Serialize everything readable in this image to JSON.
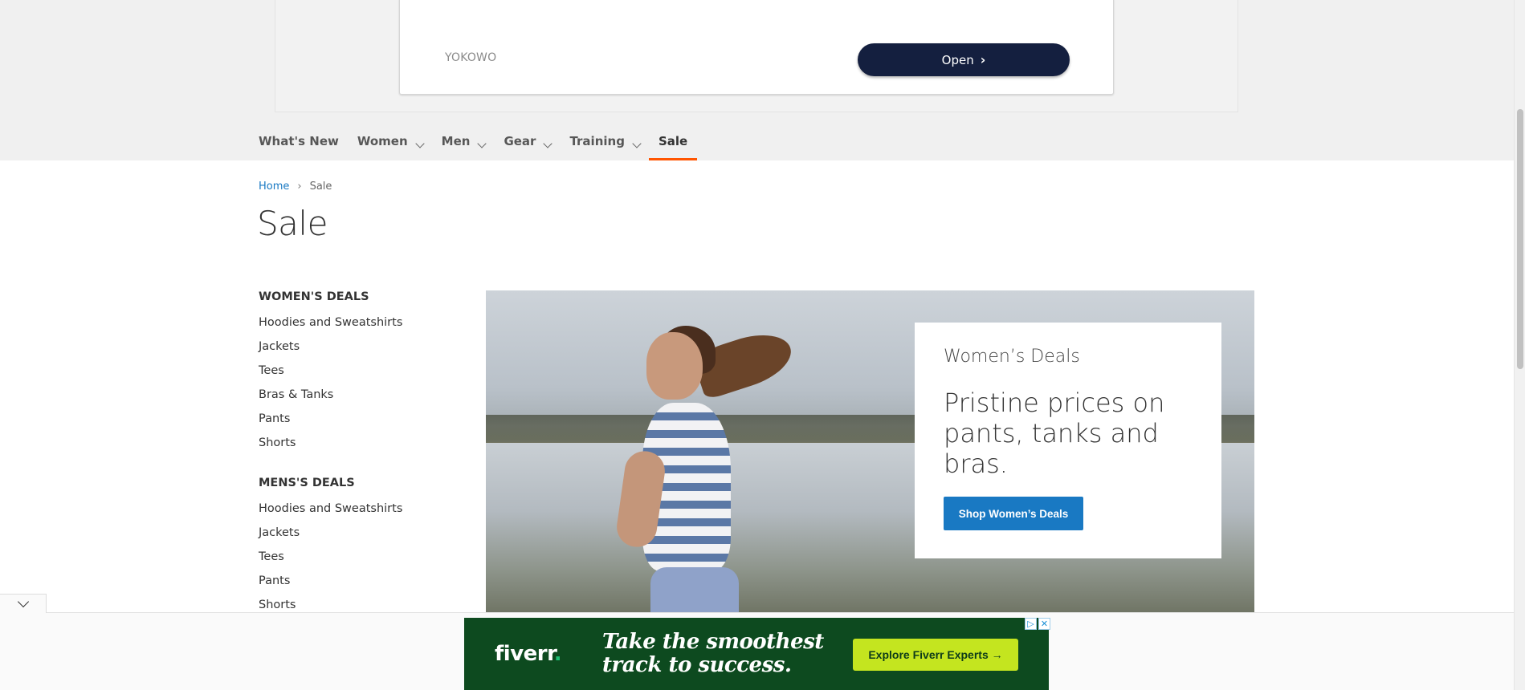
{
  "top_ad": {
    "brand": "YOKOWO",
    "button_label": "Open",
    "button_icon": "chevron-right-icon"
  },
  "nav": {
    "items": [
      {
        "label": "What's New",
        "has_dropdown": false
      },
      {
        "label": "Women",
        "has_dropdown": true
      },
      {
        "label": "Men",
        "has_dropdown": true
      },
      {
        "label": "Gear",
        "has_dropdown": true
      },
      {
        "label": "Training",
        "has_dropdown": true
      },
      {
        "label": "Sale",
        "has_dropdown": false,
        "active": true
      }
    ],
    "accent_color": "#ff5501"
  },
  "breadcrumb": {
    "home": "Home",
    "separator": "›",
    "current": "Sale"
  },
  "page_title": "Sale",
  "sidebar": {
    "groups": [
      {
        "heading": "WOMEN'S DEALS",
        "links": [
          "Hoodies and Sweatshirts",
          "Jackets",
          "Tees",
          "Bras & Tanks",
          "Pants",
          "Shorts"
        ]
      },
      {
        "heading": "MENS'S DEALS",
        "links": [
          "Hoodies and Sweatshirts",
          "Jackets",
          "Tees",
          "Pants",
          "Shorts"
        ]
      }
    ]
  },
  "hero": {
    "eyebrow": "Women’s Deals",
    "headline": "Pristine prices on pants, tanks and bras.",
    "button_label": "Shop Women’s Deals",
    "button_color": "#1979c3"
  },
  "bottom_ad": {
    "logo": "fiverr",
    "logo_dot": ".",
    "tagline_line1": "Take the smoothest",
    "tagline_line2": "track to success.",
    "button_label": "Explore Fiverr Experts →",
    "badge_play": "▷",
    "badge_close": "✕"
  }
}
